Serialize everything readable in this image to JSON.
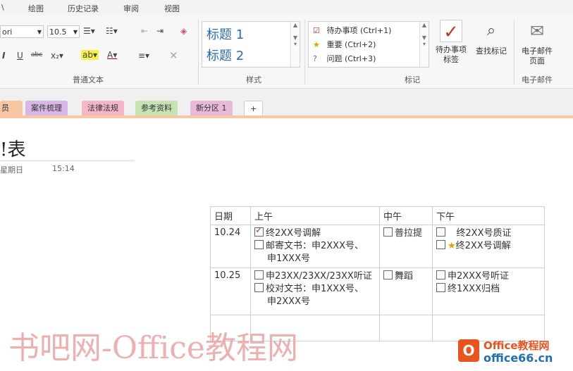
{
  "menu": {
    "items": [
      "\\",
      "绘图",
      "历史记录",
      "审阅",
      "视图"
    ]
  },
  "ribbon": {
    "basic_text": {
      "font_name": "ori",
      "font_size": "10.5",
      "label": "普通文本"
    },
    "styles": {
      "heading1": "标题 1",
      "heading2": "标题 2",
      "label": "样式"
    },
    "tags": {
      "items": [
        {
          "icon": "checkbox-icon",
          "text": "待办事项 (Ctrl+1)"
        },
        {
          "icon": "star-icon",
          "text": "重要 (Ctrl+2)"
        },
        {
          "icon": "question-icon",
          "text": "问题 (Ctrl+3)"
        }
      ],
      "todo_tag_label": [
        "待办事项",
        "标签"
      ],
      "find_tags_label": "查找标记",
      "label": "标记"
    },
    "email": {
      "button_label": [
        "电子邮件",
        "页面"
      ],
      "label": "电子邮件"
    }
  },
  "section_tabs": [
    {
      "label": "员",
      "color": "#f7c6a3"
    },
    {
      "label": "案件梳理",
      "color": "#d9b6e8"
    },
    {
      "label": "法律法规",
      "color": "#f3b7c7"
    },
    {
      "label": "参考资料",
      "color": "#c6e3b3"
    },
    {
      "label": "新分区 1",
      "color": "#e8b9d8"
    },
    {
      "label": "+",
      "color": "#ffffff"
    }
  ],
  "page": {
    "title": "!表",
    "date": "星期日",
    "time": "15:14"
  },
  "schedule": {
    "headers": [
      "日期",
      "上午",
      "中午",
      "下午"
    ],
    "rows": [
      {
        "date": "10.24",
        "morning": [
          {
            "checked": true,
            "text": "终2XX号调解"
          },
          {
            "checked": false,
            "text": "邮寄文书：申2XXX号、"
          },
          {
            "checked": null,
            "text": "申1XXX号"
          }
        ],
        "noon": [
          {
            "checked": false,
            "text": "普拉提"
          }
        ],
        "afternoon": [
          {
            "checked": false,
            "star": false,
            "text": "终2XX号质证"
          },
          {
            "checked": false,
            "star": true,
            "text": "终2XX号调解"
          }
        ]
      },
      {
        "date": "10.25",
        "morning": [
          {
            "checked": false,
            "text": "申23XX/23XX/23XX听证"
          },
          {
            "checked": false,
            "text": "校对文书：申1XXX号、"
          },
          {
            "checked": null,
            "text": "申2XXX号"
          }
        ],
        "noon": [
          {
            "checked": false,
            "text": "舞蹈"
          }
        ],
        "afternoon": [
          {
            "checked": false,
            "star": false,
            "text": "申2XXX号听证"
          },
          {
            "checked": false,
            "star": false,
            "text": "终1XXX归档"
          }
        ]
      }
    ]
  },
  "watermark": "书吧网-Office教程网",
  "logo": {
    "line1": "Office教程网",
    "line2": "office66.cn"
  }
}
